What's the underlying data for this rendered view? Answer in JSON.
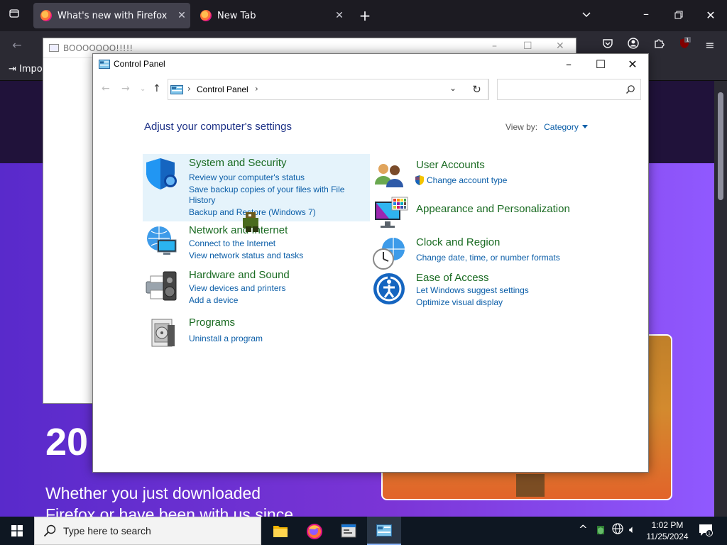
{
  "firefox": {
    "tabs": [
      {
        "title": "What's new with Firefox"
      },
      {
        "title": "New Tab"
      }
    ],
    "bookmarks_item": "Impo",
    "badge_count": "1",
    "page": {
      "big_text": "20",
      "subtitle_line1": "Whether you just downloaded",
      "subtitle_line2": "Firefox or have been with us since"
    }
  },
  "background_window": {
    "title": "BOOOOOOO!!!!!"
  },
  "control_panel": {
    "window_title": "Control Panel",
    "breadcrumb": "Control Panel",
    "search_placeholder": "",
    "heading": "Adjust your computer's settings",
    "view_by_label": "View by:",
    "view_by_value": "Category",
    "categories": {
      "system_security": {
        "title": "System and Security",
        "links": [
          "Review your computer's status",
          "Save backup copies of your files with File",
          "History",
          "Backup and Restore (Windows 7)"
        ]
      },
      "network_internet": {
        "title": "Network and Internet",
        "links": [
          "Connect to the Internet",
          "View network status and tasks"
        ]
      },
      "hardware_sound": {
        "title": "Hardware and Sound",
        "links": [
          "View devices and printers",
          "Add a device"
        ]
      },
      "programs": {
        "title": "Programs",
        "links": [
          "Uninstall a program"
        ]
      },
      "user_accounts": {
        "title": "User Accounts",
        "links": [
          "Change account type"
        ]
      },
      "appearance": {
        "title": "Appearance and Personalization",
        "links": []
      },
      "clock_region": {
        "title": "Clock and Region",
        "links": [
          "Change date, time, or number formats"
        ]
      },
      "ease_access": {
        "title": "Ease of Access",
        "links": [
          "Let Windows suggest settings",
          "Optimize visual display"
        ]
      }
    }
  },
  "taskbar": {
    "search_placeholder": "Type here to search",
    "time": "1:02 PM",
    "date": "11/25/2024",
    "notification_count": "1"
  }
}
